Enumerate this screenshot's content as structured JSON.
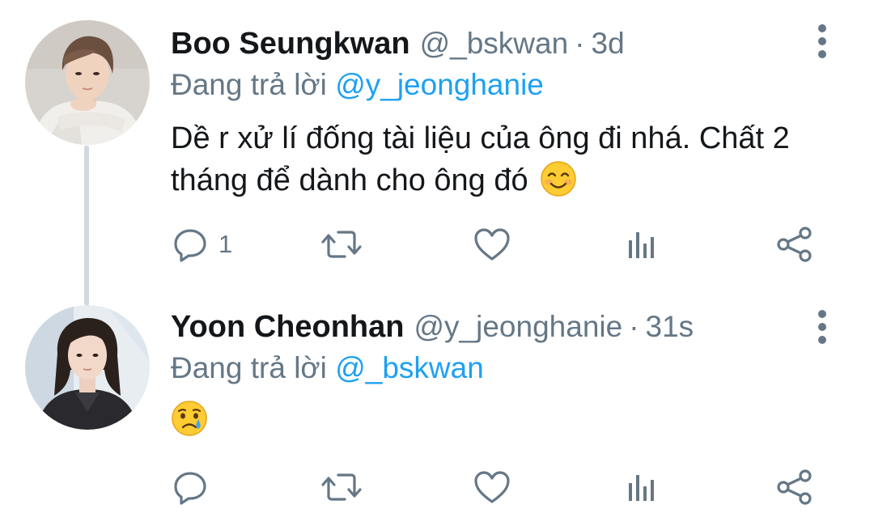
{
  "tweets": [
    {
      "author_name": "Boo Seungkwan",
      "handle": "@_bskwan",
      "separator": "·",
      "time": "3d",
      "replying_prefix": "Đang trả lời",
      "replying_to": "@y_jeonghanie",
      "text": "Dề r xử lí đống tài liệu của ông đi nhá. Chất 2 tháng để dành cho ông đó",
      "emoji": "smiling-face-icon",
      "reply_count": "1",
      "retweet_count": "",
      "like_count": ""
    },
    {
      "author_name": "Yoon Cheonhan",
      "handle": "@y_jeonghanie",
      "separator": "·",
      "time": "31s",
      "replying_prefix": "Đang trả lời",
      "replying_to": "@_bskwan",
      "text": "",
      "emoji": "crying-face-icon",
      "reply_count": "",
      "retweet_count": "",
      "like_count": ""
    }
  ],
  "colors": {
    "text": "#14171a",
    "secondary": "#657786",
    "mention": "#1da1f2",
    "thread_line": "#cfd9de",
    "icon": "#657786"
  }
}
